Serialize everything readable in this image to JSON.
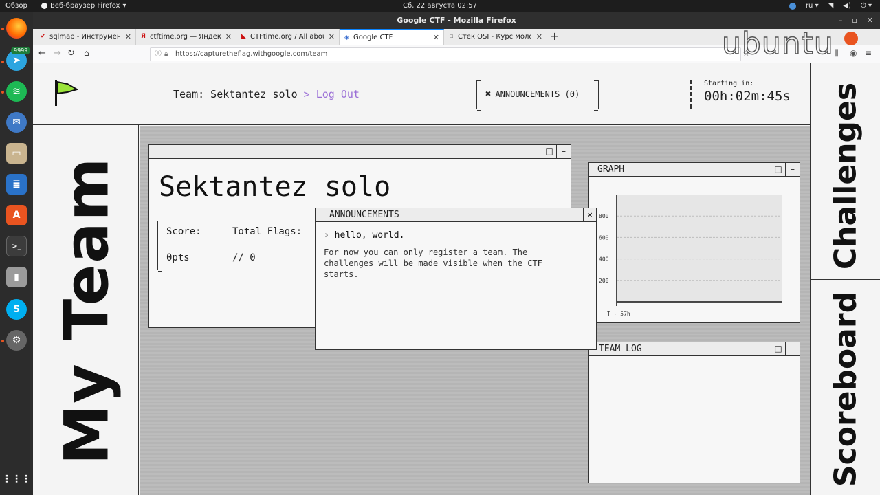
{
  "topbar": {
    "activities": "Обзор",
    "app": "Веб-браузер Firefox",
    "clock": "Сб, 22 августа  02:57",
    "lang": "ru"
  },
  "dock": {
    "badge": "9999"
  },
  "window": {
    "title": "Google CTF - Mozilla Firefox"
  },
  "tabs": [
    {
      "label": "sqlmap - Инструменты К",
      "icon": "checkmark-icon",
      "color": "#cc1111"
    },
    {
      "label": "ctftime.org — Яндекс: н",
      "icon": "yandex-icon",
      "color": "#cc1111"
    },
    {
      "label": "CTFtime.org / All about",
      "icon": "ctftime-icon",
      "color": "#cc1111"
    },
    {
      "label": "Google CTF",
      "icon": "shield-icon",
      "color": "#3b6fd1"
    },
    {
      "label": "Стек OSI - Курс молодого С",
      "icon": "page-icon",
      "color": "#777777"
    }
  ],
  "url": "https://capturetheflag.withgoogle.com/team",
  "header": {
    "team_label": "Team: Sektantez solo",
    "separator": ">",
    "logout": "Log Out",
    "announcements": "ANNOUNCEMENTS (0)",
    "starting_label": "Starting in:",
    "countdown": "00h:02m:45s"
  },
  "nav": {
    "my_team": "My Team",
    "challenges": "Challenges",
    "scoreboard": "Scoreboard"
  },
  "team_window": {
    "name": "Sektantez solo",
    "score_label": "Score:",
    "flags_label": "Total Flags:",
    "score_value": "0pts",
    "flags_value": "// 0",
    "cursor": "_"
  },
  "announcement_window": {
    "title": "ANNOUNCEMENTS",
    "close": "×",
    "heading": "hello, world.",
    "body": "For now you can only register a team. The challenges will be made visible when the CTF starts."
  },
  "graph_window": {
    "title": "GRAPH"
  },
  "log_window": {
    "title": "TEAM LOG"
  },
  "chart_data": {
    "type": "line",
    "yticks": [
      200,
      400,
      600,
      800
    ],
    "ylim": [
      0,
      1000
    ],
    "xlabel_tick": "T - 57h",
    "grid": true,
    "series": []
  }
}
